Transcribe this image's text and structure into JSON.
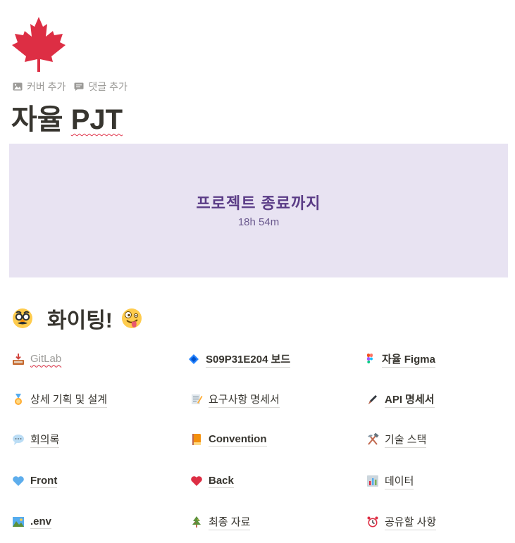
{
  "page": {
    "icon": "maple-leaf-icon",
    "add_cover": "커버 추가",
    "add_comment": "댓글 추가",
    "title_part1": "자율",
    "title_part2": "PJT"
  },
  "countdown": {
    "label": "프로젝트 종료까지",
    "value": "18h 54m",
    "background": "#e8e3f2",
    "text_color": "#5a3c86"
  },
  "heading": {
    "text": "화이팅!",
    "left_icon": "disguised-face-icon",
    "right_icon": "zany-face-icon"
  },
  "links": [
    {
      "label": "GitLab",
      "icon": "inbox-tray-icon"
    },
    {
      "label": "S09P31E204 보드",
      "icon": "blue-diamond-icon"
    },
    {
      "label": "자율 Figma",
      "icon": "figma-icon"
    },
    {
      "label": "상세 기획 및 설계",
      "icon": "medal-icon"
    },
    {
      "label": "요구사항 명세서",
      "icon": "memo-icon"
    },
    {
      "label": "API 명세서",
      "icon": "pen-icon"
    },
    {
      "label": "회의록",
      "icon": "speech-bubble-icon"
    },
    {
      "label": "Convention",
      "icon": "orange-book-icon"
    },
    {
      "label": "기술 스택",
      "icon": "hammer-pick-icon"
    },
    {
      "label": "Front",
      "icon": "blue-heart-icon"
    },
    {
      "label": "Back",
      "icon": "red-heart-icon"
    },
    {
      "label": "데이터",
      "icon": "bar-chart-icon"
    },
    {
      "label": ".env",
      "icon": "landscape-icon"
    },
    {
      "label": "최종 자료",
      "icon": "christmas-tree-icon"
    },
    {
      "label": "공유할 사항",
      "icon": "alarm-clock-icon"
    }
  ]
}
